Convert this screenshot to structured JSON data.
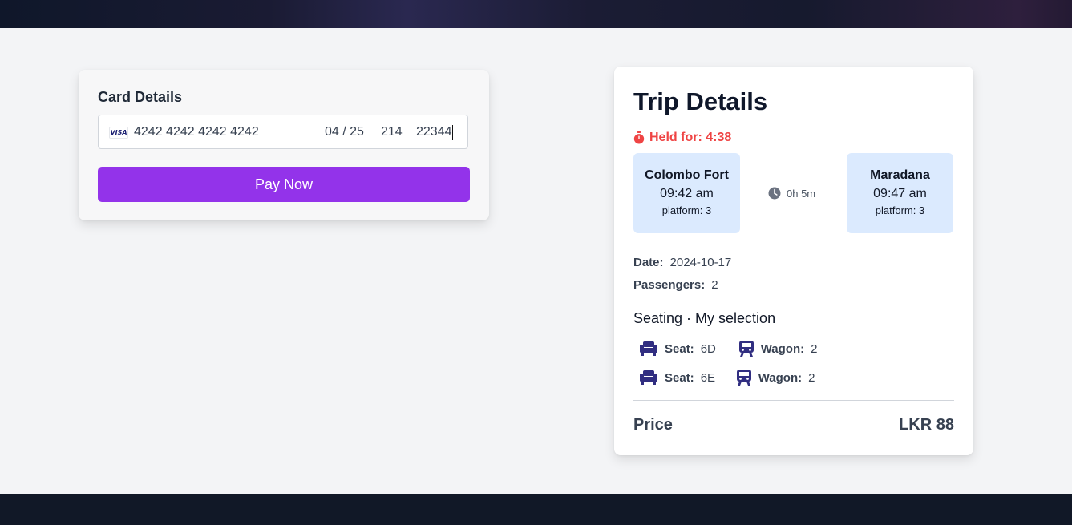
{
  "payment": {
    "card_label": "Card Details",
    "card_brand": "VISA",
    "card_number": "4242 4242 4242 4242",
    "expiry": "04 / 25",
    "cvc": "214",
    "zip": "22344",
    "pay_button": "Pay Now",
    "accent_color": "#9333ea"
  },
  "trip": {
    "title": "Trip Details",
    "held_for": "Held for: 4:38",
    "from": {
      "name": "Colombo Fort",
      "time": "09:42 am",
      "platform": "platform: 3"
    },
    "to": {
      "name": "Maradana",
      "time": "09:47 am",
      "platform": "platform: 3"
    },
    "duration": "0h 5m",
    "date_label": "Date:",
    "date": "2024-10-17",
    "passengers_label": "Passengers:",
    "passengers": "2",
    "seating_title": "Seating · My selection",
    "seats": [
      {
        "seat_label": "Seat:",
        "seat": "6D",
        "wagon_label": "Wagon:",
        "wagon": "2"
      },
      {
        "seat_label": "Seat:",
        "seat": "6E",
        "wagon_label": "Wagon:",
        "wagon": "2"
      }
    ],
    "price_label": "Price",
    "price": "LKR 88",
    "held_color": "#ef4444",
    "station_box_color": "#dbeafe"
  },
  "icons": {
    "timer": "stopwatch-icon",
    "duration": "clock-icon",
    "seat": "armchair-icon",
    "wagon": "train-icon",
    "card_brand": "visa-icon"
  }
}
